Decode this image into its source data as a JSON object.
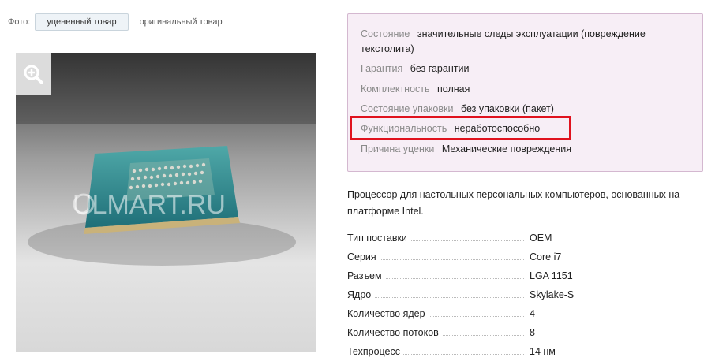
{
  "photo_bar": {
    "label": "Фото:",
    "tab_active": "уцененный товар",
    "tab_inactive": "оригинальный товар"
  },
  "image": {
    "watermark": "ULMART.RU",
    "zoom_icon": "zoom-in-icon"
  },
  "condition": [
    {
      "key": "Состояние",
      "value": "значительные следы эксплуатации (повреждение"
    },
    {
      "key": "",
      "value": "текстолита)"
    },
    {
      "key": "Гарантия",
      "value": "без гарантии"
    },
    {
      "key": "Комплектность",
      "value": "полная"
    },
    {
      "key": "Состояние упаковки",
      "value": "без упаковки (пакет)"
    },
    {
      "key": "Функциональность",
      "value": "неработоспособно"
    },
    {
      "key": "Причина уценки",
      "value": "Механические повреждения"
    }
  ],
  "description": "Процессор для настольных персональных компьютеров, основанных на платформе Intel.",
  "specs": [
    {
      "key": "Тип поставки",
      "value": "OEM"
    },
    {
      "key": "Серия",
      "value": "Core i7"
    },
    {
      "key": "Разъем",
      "value": "LGA 1151"
    },
    {
      "key": "Ядро",
      "value": "Skylake-S"
    },
    {
      "key": "Количество ядер",
      "value": "4"
    },
    {
      "key": "Количество потоков",
      "value": "8"
    },
    {
      "key": "Техпроцесс",
      "value": "14 нм"
    }
  ],
  "colors": {
    "panel_bg": "#f7eef6",
    "panel_border": "#d4b8d0",
    "highlight": "#e0121e"
  }
}
